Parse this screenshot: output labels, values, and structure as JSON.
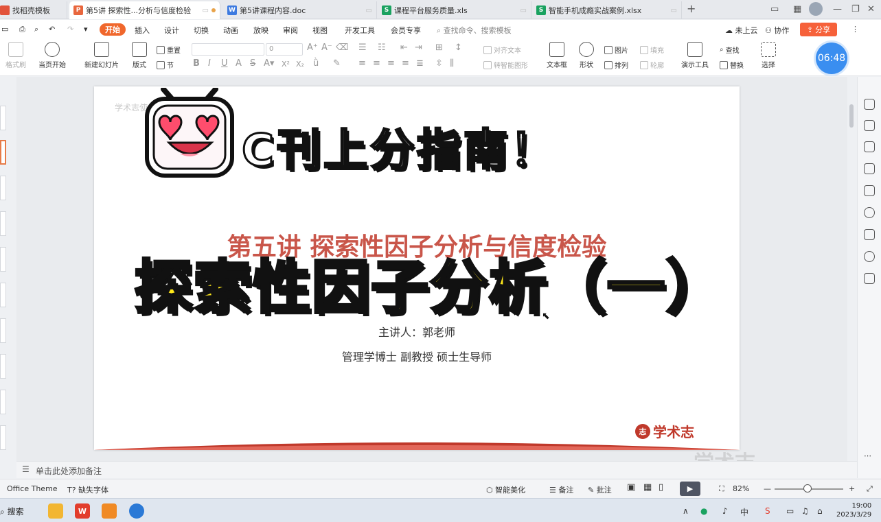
{
  "tabs": [
    {
      "label": "找稻壳模板",
      "icon": "wps-icon",
      "color": "#e2533b"
    },
    {
      "label": "第5讲 探索性...分析与信度检验",
      "icon": "presentation-file-icon",
      "color": "#e8663d",
      "active": true
    },
    {
      "label": "第5讲课程内容.doc",
      "icon": "word-file-icon",
      "color": "#3e7be0"
    },
    {
      "label": "课程平台服务质量.xls",
      "icon": "spreadsheet-file-icon",
      "color": "#1aa260"
    },
    {
      "label": "智能手机成瘾实战案例.xlsx",
      "icon": "spreadsheet-file-icon",
      "color": "#1aa260"
    }
  ],
  "tab_badge_letters": {
    "presentation": "P",
    "word": "W",
    "spreadsheet": "S"
  },
  "menu": {
    "start": "开始",
    "items": [
      "插入",
      "设计",
      "切换",
      "动画",
      "放映",
      "审阅",
      "视图",
      "开发工具",
      "会员专享"
    ],
    "search_placeholder": "查找命令、搜索模板",
    "cloud": "未上云",
    "collab": "协作",
    "share": "分享"
  },
  "ribbon": {
    "format_painter": "格式刷",
    "from_current": "当页开始",
    "new_slide": "新建幻灯片",
    "layout": "版式",
    "reset": "重置",
    "section": "节",
    "font_size": "0",
    "align_text": "对齐文本",
    "smart_convert": "转智能图形",
    "textbox": "文本框",
    "shape": "形状",
    "picture": "图片",
    "arrange": "排列",
    "fill": "填充",
    "outline": "轮廓",
    "present_tools": "演示工具",
    "find": "查找",
    "replace": "替换",
    "select": "选择",
    "timer": "06:48"
  },
  "slide": {
    "header": "学术志使命：助力科研群体成长",
    "title": "第五讲  探索性因子分析与信度检验",
    "speaker": "主讲人：郭老师",
    "credentials": "管理学博士    副教授    硕士生导师",
    "logo_text": "学术志",
    "accent": "#c0392b"
  },
  "overlay": {
    "caption_top": "C刊上分指南！",
    "caption_main": "探索性因子分析（一）",
    "watermark": "学术志",
    "caption_color": "#ffe81a"
  },
  "notes_placeholder": "单击此处添加备注",
  "status": {
    "theme": "Office Theme",
    "missing_fonts": "缺失字体",
    "smart_beautify": "智能美化",
    "notes": "备注",
    "comments": "批注",
    "zoom": "82%"
  },
  "taskbar": {
    "search": "搜索",
    "time": "19:00",
    "date": "2023/3/29",
    "lang": "中"
  }
}
